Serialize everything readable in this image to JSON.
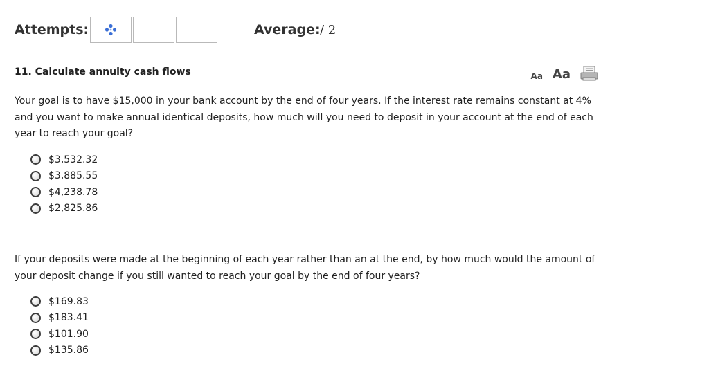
{
  "header": {
    "attempts_label": "Attempts:",
    "attempt_icon": "blue-diamond-dots-icon",
    "average_label": "Average:",
    "average_value": "/ 2"
  },
  "question": {
    "title": "11. Calculate annuity cash flows",
    "font_small_label": "Aa",
    "font_large_label": "Aa",
    "print_icon": "printer-icon"
  },
  "part1": {
    "text": "Your goal is to have $15,000 in your bank account by the end of four years. If the interest rate remains constant at 4% and you want to make annual identical deposits, how much will you need to deposit in your account at the end of each year to reach your goal?",
    "options": [
      "$3,532.32",
      "$3,885.55",
      "$4,238.78",
      "$2,825.86"
    ]
  },
  "part2": {
    "text": "If your deposits were made at the beginning of each year rather than an at the end, by how much would the amount of your deposit change if you still wanted to reach your goal by the end of four years?",
    "options": [
      "$169.83",
      "$183.41",
      "$101.90",
      "$135.86"
    ]
  },
  "colors": {
    "accent_icon": "#3b6fd6",
    "radio_border": "#3c3c3c",
    "box_border": "#b9b9b9"
  }
}
